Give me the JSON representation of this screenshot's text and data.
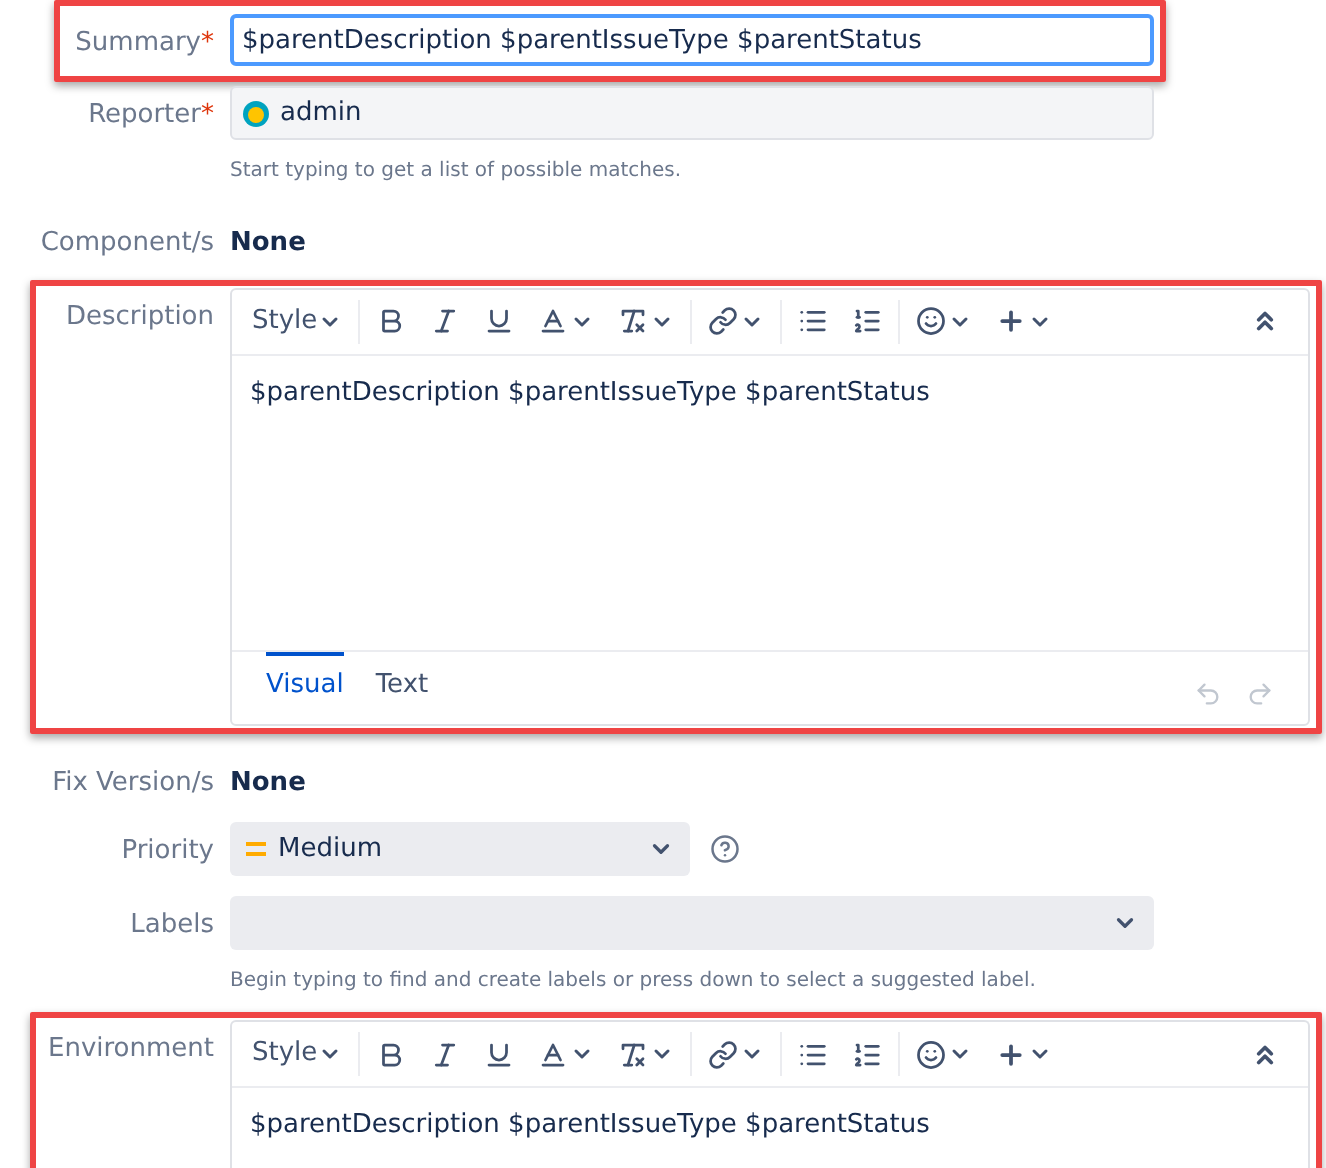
{
  "fields": [
    {
      "kind": "text_input",
      "label": "Summary",
      "required_mark": "*",
      "highlighted": true,
      "value": "$parentDescription $parentIssueType $parentStatus",
      "focused": true
    },
    {
      "kind": "user_picker",
      "label": "Reporter",
      "required_mark": "*",
      "highlighted": false,
      "value": "admin",
      "hint": "Start typing to get a list of possible matches."
    },
    {
      "kind": "readonly",
      "label": "Component/s",
      "highlighted": false,
      "value": "None"
    },
    {
      "kind": "rich_editor",
      "label": "Description",
      "highlighted": true,
      "style_label": "Style",
      "value": "$parentDescription $parentIssueType $parentStatus",
      "tabs": [
        {
          "label": "Visual",
          "selected": true
        },
        {
          "label": "Text",
          "selected": false
        }
      ]
    },
    {
      "kind": "readonly",
      "label": "Fix Version/s",
      "highlighted": false,
      "value": "None"
    },
    {
      "kind": "select",
      "label": "Priority",
      "highlighted": false,
      "value": "Medium"
    },
    {
      "kind": "labels",
      "label": "Labels",
      "highlighted": false,
      "hint": "Begin typing to find and create labels or press down to select a suggested label."
    },
    {
      "kind": "rich_editor",
      "label": "Environment",
      "highlighted": true,
      "style_label": "Style",
      "value": "$parentDescription $parentIssueType $parentStatus",
      "cut": true
    }
  ]
}
